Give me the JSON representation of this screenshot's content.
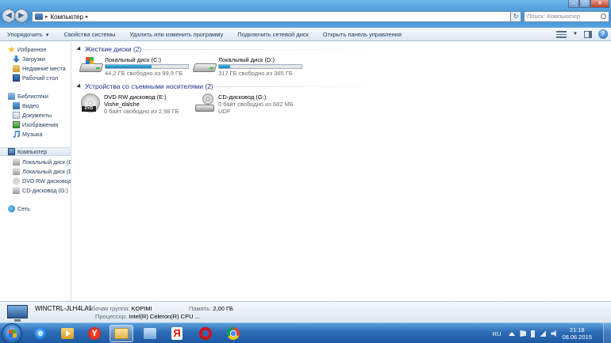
{
  "address": {
    "path": [
      "Компьютер"
    ],
    "search_placeholder": "Поиск: Компьютер"
  },
  "command_bar": {
    "organize": "Упорядочить",
    "system_properties": "Свойства системы",
    "uninstall": "Удалить или изменить программу",
    "map_drive": "Подключить сетевой диск",
    "control_panel": "Открыть панель управления"
  },
  "nav": {
    "favorites": "Избранное",
    "downloads": "Загрузки",
    "recent": "Недавние места",
    "desktop": "Рабочий стол",
    "libraries": "Библиотеки",
    "video": "Видео",
    "documents": "Документы",
    "images": "Изображения",
    "music": "Музыка",
    "computer": "Компьютер",
    "drive_c": "Локальный диск (C",
    "drive_d": "Локальный диск (D",
    "drive_e": "DVD RW дисковод (",
    "drive_g": "CD-дисковод (G:)",
    "network": "Сеть"
  },
  "groups": {
    "hdd": "Жесткие диски (2)",
    "removable": "Устройства со съемными носителями (2)"
  },
  "drives": {
    "c": {
      "name": "Локальный диск (C:)",
      "free": "44,2 ГБ свободно из 99,9 ГБ",
      "used_fraction": 0.56
    },
    "d": {
      "name": "Локальный диск (D:)",
      "free": "317 ГБ свободно из 365 ГБ",
      "used_fraction": 0.13
    },
    "e": {
      "name": "DVD RW дисковод (E:)",
      "label": "Vishe_dalshe",
      "free": "0 байт свободно из 2,98 ГБ",
      "icon_text": "DVD"
    },
    "g": {
      "name": "CD-дисковод (G:)",
      "free": "0 байт свободно из 682 МБ",
      "fs": "UDF"
    }
  },
  "details": {
    "pc_name": "WINCTRL-JLH4LA1",
    "workgroup_key": "Рабочая группа:",
    "workgroup": "KOPIMI",
    "memory_key": "Память:",
    "memory": "2,00 ГБ",
    "cpu_key": "Процессор:",
    "cpu": "Intel(R) Celeron(R) CPU ..."
  },
  "taskbar": {
    "lang": "RU",
    "time": "21:18",
    "date": "08.06.2015",
    "ie_glyph": "e",
    "yb_glyph": "Y",
    "yandex_glyph": "Я"
  }
}
